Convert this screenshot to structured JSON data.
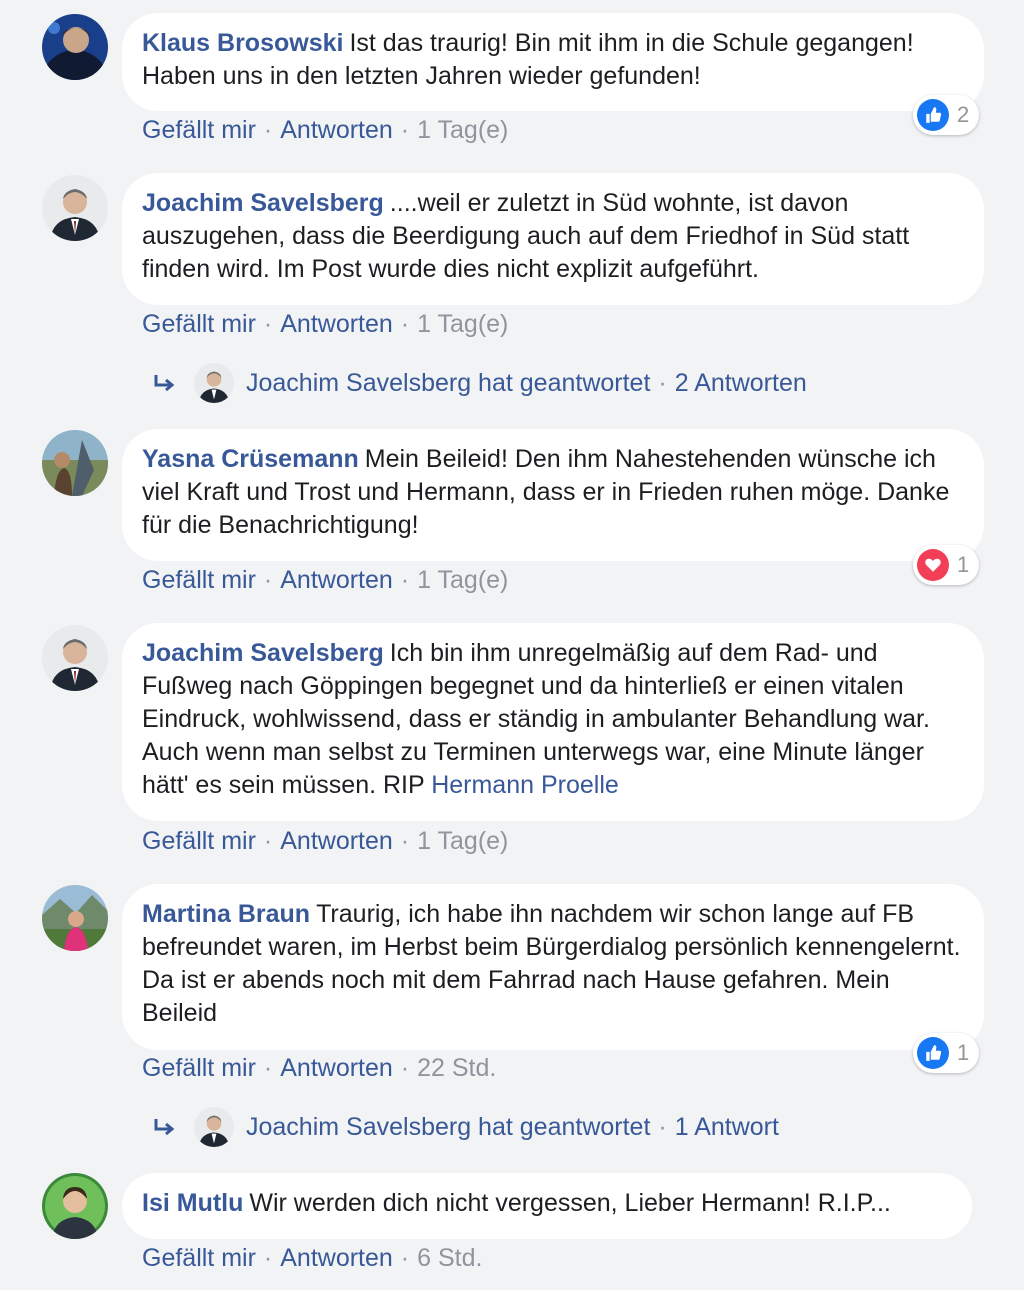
{
  "action_labels": {
    "like": "Gefällt mir",
    "reply": "Antworten",
    "separator": "·"
  },
  "colors": {
    "link": "#385898",
    "muted": "#90949c",
    "like_blue": "#1877f2",
    "love_red": "#f33e58"
  },
  "comments": [
    {
      "author": "Klaus Brosowski",
      "text": "Ist das traurig! Bin mit ihm in die Schule gegangen! Haben uns in den letzten Jahren wieder gefunden!",
      "time": "1 Tag(e)",
      "reaction": {
        "icon": "like-icon",
        "count": "2"
      }
    },
    {
      "author": "Joachim Savelsberg",
      "text": "....weil er zuletzt in Süd wohnte, ist davon auszugehen, dass die Beerdigung auch auf dem Friedhof in Süd statt finden wird. Im Post wurde dies nicht explizit aufgeführt.",
      "time": "1 Tag(e)",
      "replies": {
        "text": "Joachim Savelsberg hat geantwortet",
        "count": "2 Antworten"
      }
    },
    {
      "author": "Yasna Crüsemann",
      "text": "Mein Beileid! Den ihm Nahestehenden wünsche ich viel Kraft und Trost und Hermann, dass er in Frieden ruhen möge. Danke für die Benachrichtigung!",
      "time": "1 Tag(e)",
      "reaction": {
        "icon": "love-icon",
        "count": "1"
      }
    },
    {
      "author": "Joachim Savelsberg",
      "text": "Ich bin ihm unregelmäßig auf dem Rad- und Fußweg nach Göppingen begegnet und da hinterließ er einen vitalen Eindruck, wohlwissend, dass er ständig in ambulanter Behandlung war. Auch wenn man selbst zu Terminen unterwegs war, eine Minute länger hätt' es sein müssen. RIP",
      "mention": "Hermann Proelle",
      "time": "1 Tag(e)"
    },
    {
      "author": "Martina Braun",
      "text": "Traurig, ich habe ihn nachdem wir schon lange auf FB befreundet waren, im Herbst beim Bürgerdialog persönlich kennengelernt. Da ist er abends noch mit dem Fahrrad nach Hause gefahren. Mein Beileid",
      "time": "22 Std.",
      "reaction": {
        "icon": "like-icon",
        "count": "1"
      },
      "replies": {
        "text": "Joachim Savelsberg hat geantwortet",
        "count": "1 Antwort"
      }
    },
    {
      "author": "Isi Mutlu",
      "text": "Wir werden dich nicht vergessen, Lieber Hermann! R.I.P...",
      "time": "6 Std."
    }
  ]
}
